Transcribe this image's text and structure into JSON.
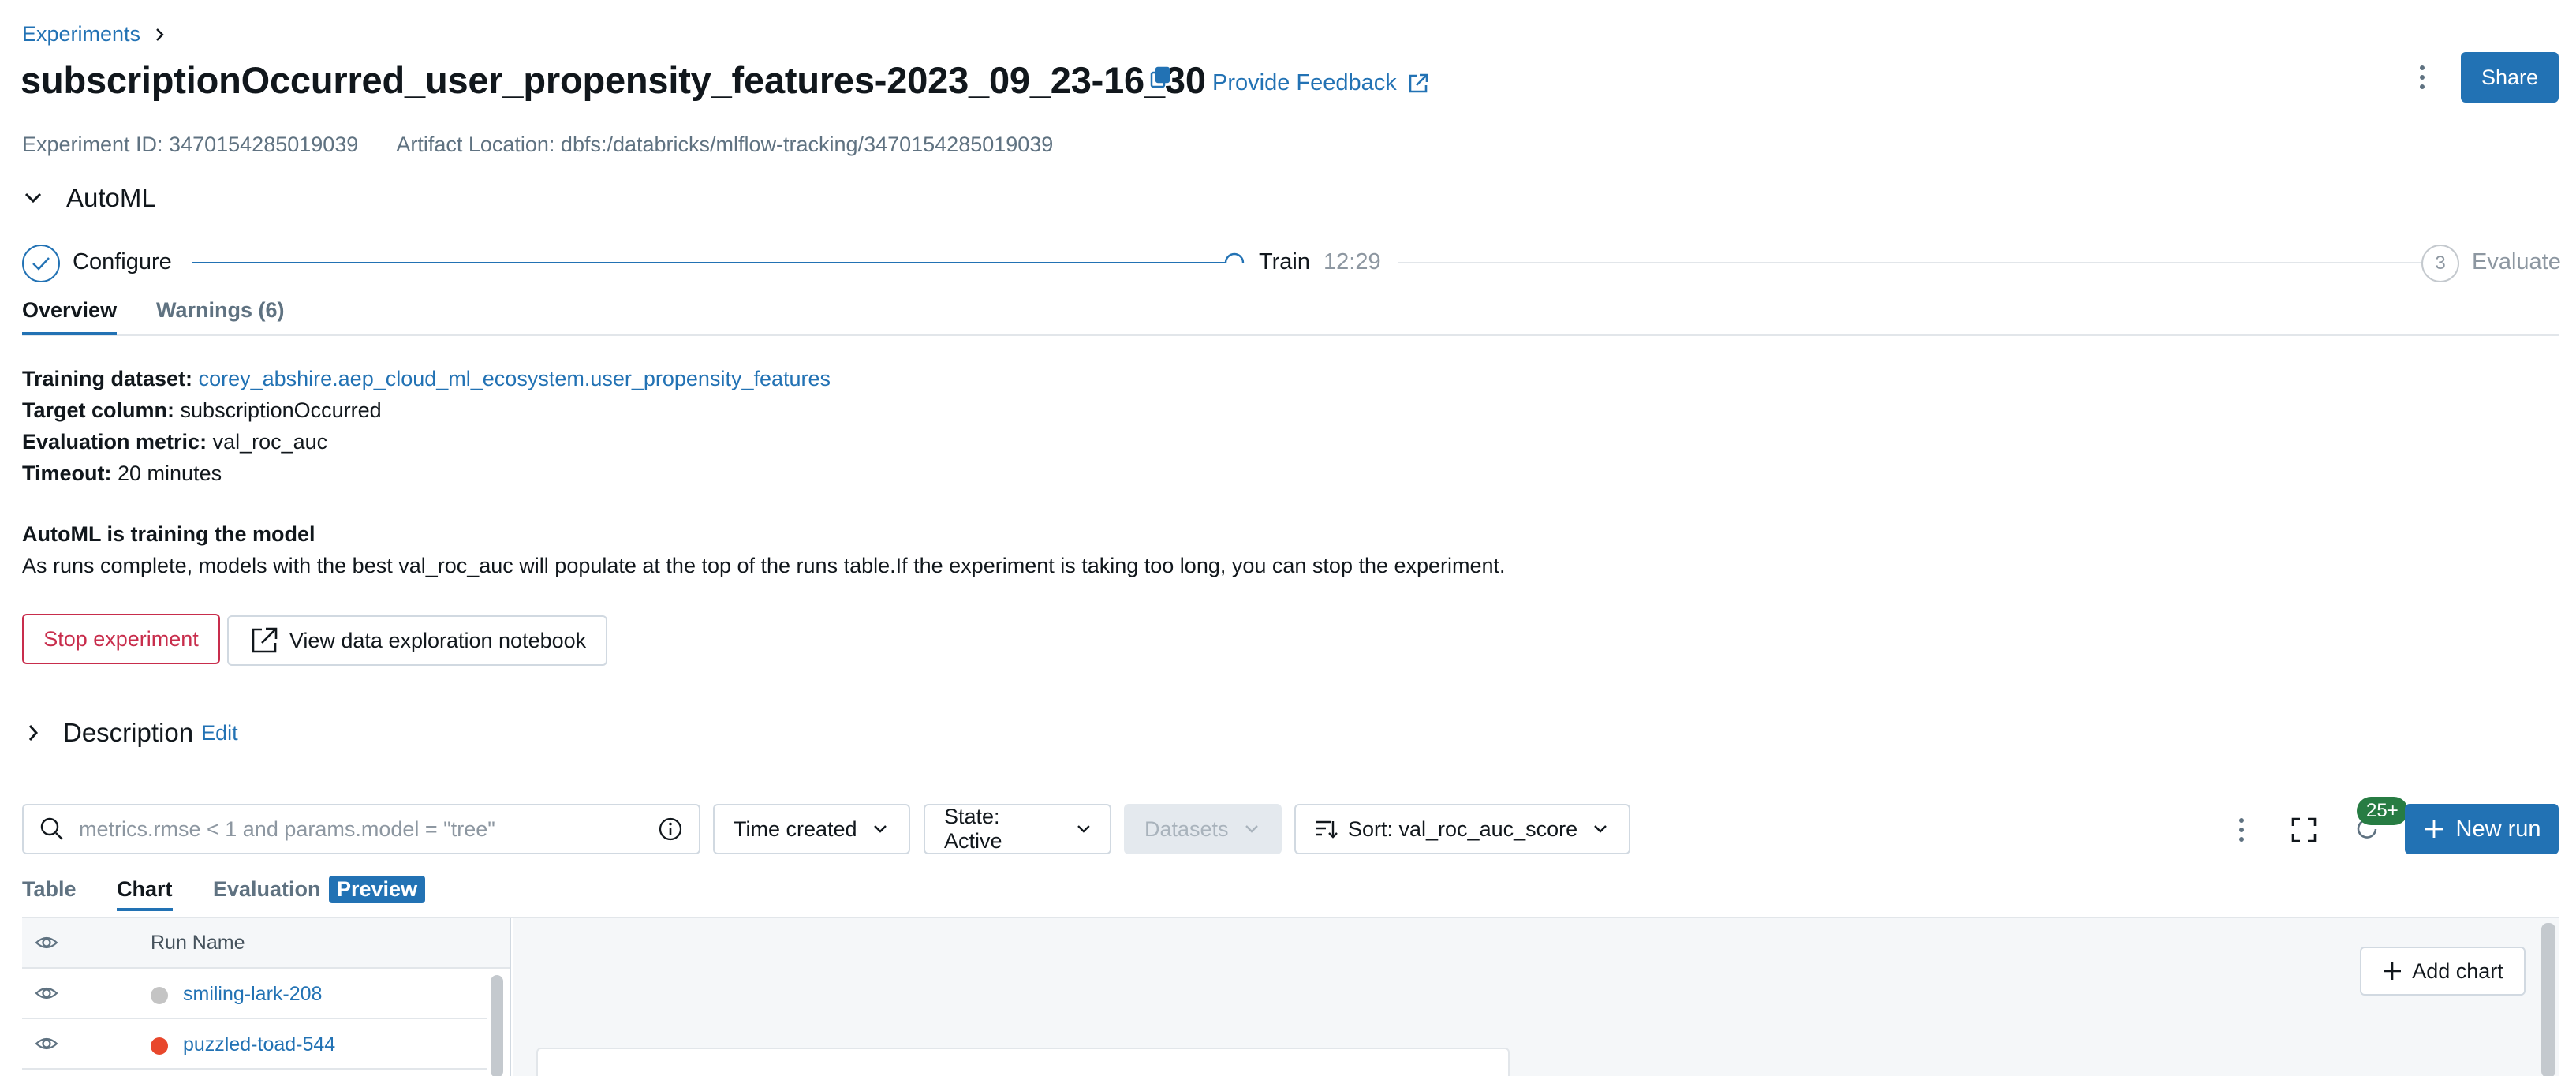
{
  "breadcrumb": {
    "label": "Experiments"
  },
  "header": {
    "title": "subscriptionOccurred_user_propensity_features-2023_09_23-16_30",
    "feedback_label": "Provide Feedback",
    "share_label": "Share"
  },
  "meta": {
    "experiment_id": "Experiment ID: 3470154285019039",
    "artifact_location": "Artifact Location: dbfs:/databricks/mlflow-tracking/3470154285019039"
  },
  "automl": {
    "title": "AutoML",
    "steps": [
      {
        "label": "Configure",
        "status": "done"
      },
      {
        "label": "Train",
        "status": "running",
        "time": "12:29"
      },
      {
        "label": "Evaluate",
        "status": "pending",
        "number": "3"
      }
    ],
    "tabs": [
      {
        "label": "Overview",
        "active": true
      },
      {
        "label": "Warnings (6)",
        "active": false
      }
    ],
    "info": {
      "training_dataset_label": "Training dataset:",
      "training_dataset_value": "corey_abshire.aep_cloud_ml_ecosystem.user_propensity_features",
      "target_column_label": "Target column:",
      "target_column_value": "subscriptionOccurred",
      "evaluation_metric_label": "Evaluation metric:",
      "evaluation_metric_value": "val_roc_auc",
      "timeout_label": "Timeout:",
      "timeout_value": "20 minutes"
    },
    "training_title": "AutoML is training the model",
    "training_desc": "As runs complete, models with the best val_roc_auc will populate at the top of the runs table.If the experiment is taking too long, you can stop the experiment.",
    "stop_label": "Stop experiment",
    "notebook_label": "View data exploration notebook"
  },
  "description": {
    "title": "Description",
    "edit_label": "Edit"
  },
  "toolbar": {
    "search_placeholder": "metrics.rmse < 1 and params.model = \"tree\"",
    "time_created": "Time created",
    "state": "State: Active",
    "datasets": "Datasets",
    "sort": "Sort: val_roc_auc_score",
    "refresh_badge": "25+",
    "new_run_label": "New run"
  },
  "view_tabs": {
    "table": "Table",
    "chart": "Chart",
    "evaluation": "Evaluation",
    "preview": "Preview"
  },
  "runs": {
    "column_header": "Run Name",
    "rows": [
      {
        "name": "smiling-lark-208",
        "color": "#c4c4c4"
      },
      {
        "name": "puzzled-toad-544",
        "color": "#e8472c"
      }
    ]
  },
  "chart_panel": {
    "add_chart_label": "Add chart"
  },
  "colors": {
    "accent": "#2272b4",
    "danger": "#c82d4c",
    "success_badge": "#277c43"
  }
}
